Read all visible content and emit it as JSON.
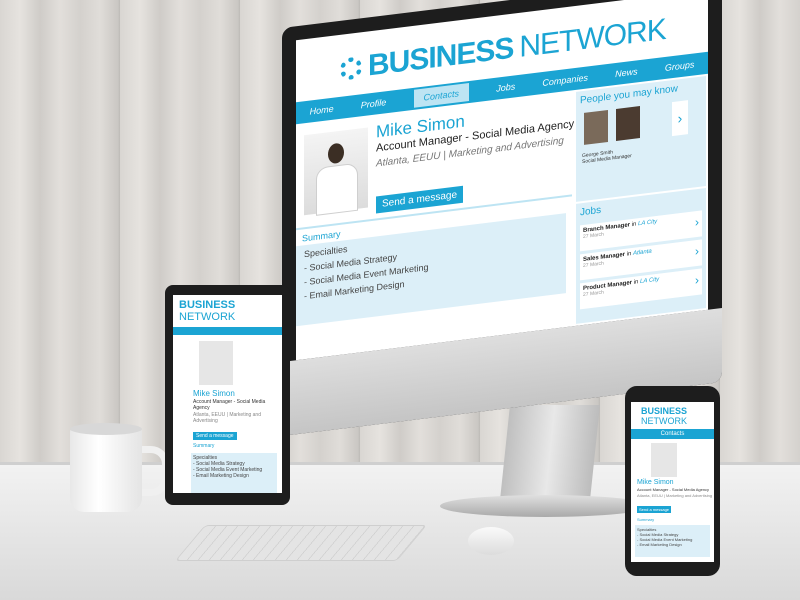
{
  "brand": {
    "business": "BUSINESS",
    "network": "NETWORK",
    "accent": "#1ba4d3",
    "panel": "#dceff8"
  },
  "desktop": {
    "nav": [
      "Home",
      "Profile",
      "Contacts",
      "Jobs",
      "Companies",
      "News",
      "Groups"
    ],
    "active_nav": "Contacts",
    "profile": {
      "name": "Mike Simon",
      "title": "Account Manager - Social Media Agency",
      "location": "Atlanta, EEUU  |  Marketing and Advertising",
      "send_button": "Send a message"
    },
    "summary": {
      "heading": "Summary",
      "lines": [
        "Specialties",
        "- Social Media Strategy",
        "- Social Media Event Marketing",
        "- Email Marketing Design"
      ]
    },
    "people": {
      "heading": "People you may know",
      "person_name": "George Smith",
      "person_role": "Social Media Manager"
    },
    "jobs": {
      "heading": "Jobs",
      "items": [
        {
          "title": "Branch Manager",
          "in": "in",
          "city": "LA City",
          "date": "27 March"
        },
        {
          "title": "Sales Manager",
          "in": "in",
          "city": "Atlanta",
          "date": "27 March"
        },
        {
          "title": "Product Manager",
          "in": "in",
          "city": "LA City",
          "date": "27 March"
        }
      ]
    }
  },
  "tablet": {
    "name": "Mike Simon",
    "title": "Account Manager - Social Media Agency",
    "location": "Atlanta, EEUU  |  Marketing and Advertising",
    "send_button": "Send a message",
    "summary_heading": "Summary",
    "summary_lines": [
      "Specialties",
      "- Social Media Strategy",
      "- Social Media Event Marketing",
      "- Email Marketing Design"
    ]
  },
  "phone": {
    "nav_label": "Contacts",
    "name": "Mike Simon",
    "title": "Account Manager - Social Media Agency",
    "location": "Atlanta, EEUU  |  Marketing and Advertising",
    "send_button": "Send a message",
    "summary_heading": "Summary",
    "summary_lines": [
      "Specialties",
      "- Social Media Strategy",
      "- Social Media Event Marketing",
      "- Email Marketing Design"
    ]
  }
}
